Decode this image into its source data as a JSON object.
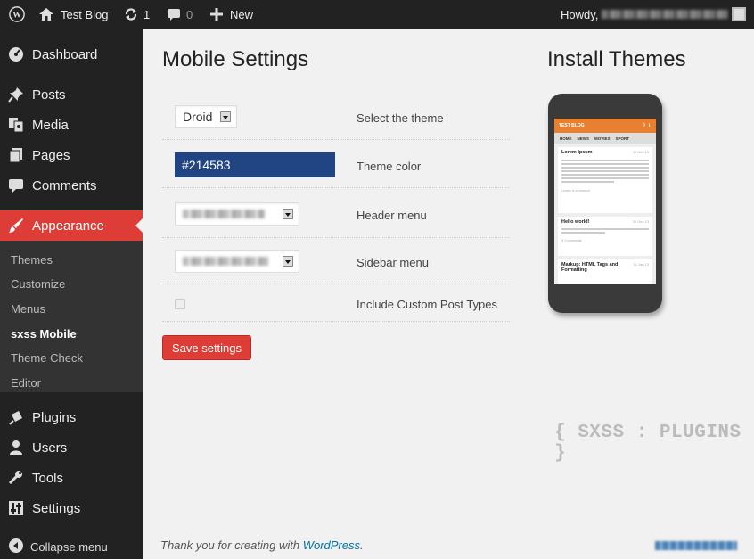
{
  "adminbar": {
    "site_name": "Test Blog",
    "updates_count": "1",
    "comments_count": "0",
    "new_label": "New",
    "howdy_label": "Howdy,"
  },
  "sidebar": {
    "items_top": [
      {
        "label": "Dashboard",
        "icon": "dashboard-icon"
      },
      {
        "label": "Posts",
        "icon": "pushpin-icon"
      },
      {
        "label": "Media",
        "icon": "media-icon"
      },
      {
        "label": "Pages",
        "icon": "pages-icon"
      },
      {
        "label": "Comments",
        "icon": "comment-icon"
      }
    ],
    "current_item": {
      "label": "Appearance",
      "icon": "paintbrush-icon"
    },
    "submenu": [
      "Themes",
      "Customize",
      "Menus",
      "sxss Mobile",
      "Theme Check",
      "Editor"
    ],
    "items_bottom": [
      {
        "label": "Plugins",
        "icon": "plugin-icon"
      },
      {
        "label": "Users",
        "icon": "users-icon"
      },
      {
        "label": "Tools",
        "icon": "wrench-icon"
      },
      {
        "label": "Settings",
        "icon": "settings-icon"
      }
    ],
    "collapse_label": "Collapse menu"
  },
  "main": {
    "title": "Mobile Settings",
    "theme_select_value": "Droid",
    "theme_label": "Select the theme",
    "theme_color_value": "#214583",
    "theme_color_label": "Theme color",
    "header_menu_label": "Header menu",
    "sidebar_menu_label": "Sidebar menu",
    "custom_post_label": "Include Custom Post Types",
    "save_label": "Save settings"
  },
  "themes": {
    "title": "Install Themes",
    "phone": {
      "blog_title": "TEST BLOG",
      "nav": [
        "HOME",
        "NEWS",
        "MOVIES",
        "SPORT"
      ],
      "posts": [
        {
          "title": "Lorem Ipsum",
          "date": "30 Dec 13",
          "meta": "Leave a comment"
        },
        {
          "title": "Hello world!",
          "date": "30 Dec 13",
          "meta": "3 Comments"
        },
        {
          "title": "Markup: HTML Tags and Formatting",
          "date": "11 Jan 13",
          "meta": ""
        }
      ]
    },
    "brand": "{ SXSS : PLUGINS }"
  },
  "footer": {
    "text": "Thank you for creating with",
    "link": "WordPress",
    "suffix": "."
  },
  "colors": {
    "accent": "#dd3d36",
    "theme_color": "#214583",
    "sidebar": "#222222",
    "phone_header": "#e8802f"
  }
}
